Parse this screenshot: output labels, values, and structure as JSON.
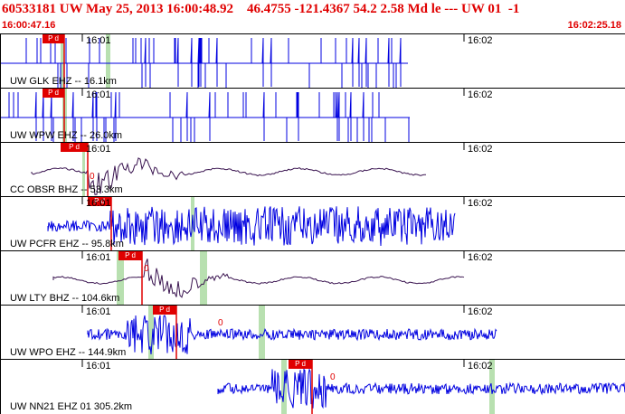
{
  "header": {
    "title": "60533181 UW May 25, 2013 16:00:48.92    46.4755 -121.4367 54.2 2.58 Md le --- UW 01  -1",
    "time_start": "16:00:47.16",
    "time_end": "16:02:25.18"
  },
  "tick_labels": {
    "t1": "16:01",
    "t2": "16:02"
  },
  "pick_label": "P d",
  "zero_label": "0",
  "colors": {
    "trace_blue": "#0000e0",
    "trace_dark": "#3a1450",
    "pick_red": "#e00000",
    "window_green": "#b8e0b0"
  },
  "panels": [
    {
      "channel": "UW GLK EHZ -- 16.1km",
      "style": "spiky"
    },
    {
      "channel": "UW WPW EHZ -- 26.0km",
      "style": "spiky"
    },
    {
      "channel": "CC OBSR BHZ -- 53.3km",
      "style": "slow"
    },
    {
      "channel": "UW PCFR EHZ -- 95.8km",
      "style": "noisy"
    },
    {
      "channel": "UW LTY BHZ -- 104.6km",
      "style": "slow"
    },
    {
      "channel": "UW WPO EHZ -- 144.9km",
      "style": "noisy"
    },
    {
      "channel": "UW NN21 EHZ 01 305.2km",
      "style": "noisy"
    }
  ]
}
